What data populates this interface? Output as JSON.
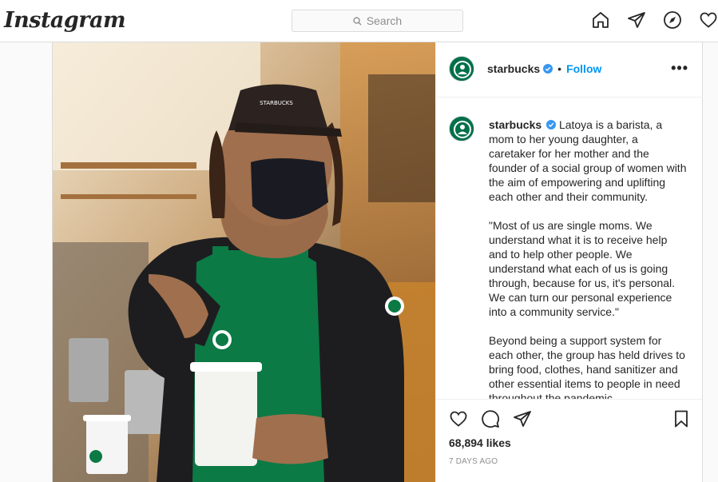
{
  "header": {
    "logo": "Instagram",
    "search_placeholder": "Search",
    "icons": [
      "home-icon",
      "direct-message-icon",
      "explore-icon",
      "activity-heart-icon"
    ]
  },
  "post": {
    "username": "starbucks",
    "follow_label": "Follow",
    "dot": "•",
    "more_label": "•••",
    "caption_paragraphs": [
      "Latoya is a barista, a mom to her young daughter, a caretaker for her mother and the founder of a social group of women with the aim of empowering and uplifting each other and their community.",
      "\"Most of us are single moms. We understand what it is to receive help and to help other people. We understand what each of us is going through, because for us, it's personal. We can turn our personal experience into a community service.\"",
      "Beyond being a support system for each other, the group has held drives to bring food, clothes, hand sanitizer and other essential items to people in need throughout the pandemic."
    ],
    "likes": "68,894 likes",
    "date": "7 DAYS AGO",
    "image_description_icon": "barista-photo"
  },
  "colors": {
    "accent": "#0095f6",
    "border": "#dbdbdb",
    "starbucks_green": "#00704a"
  }
}
